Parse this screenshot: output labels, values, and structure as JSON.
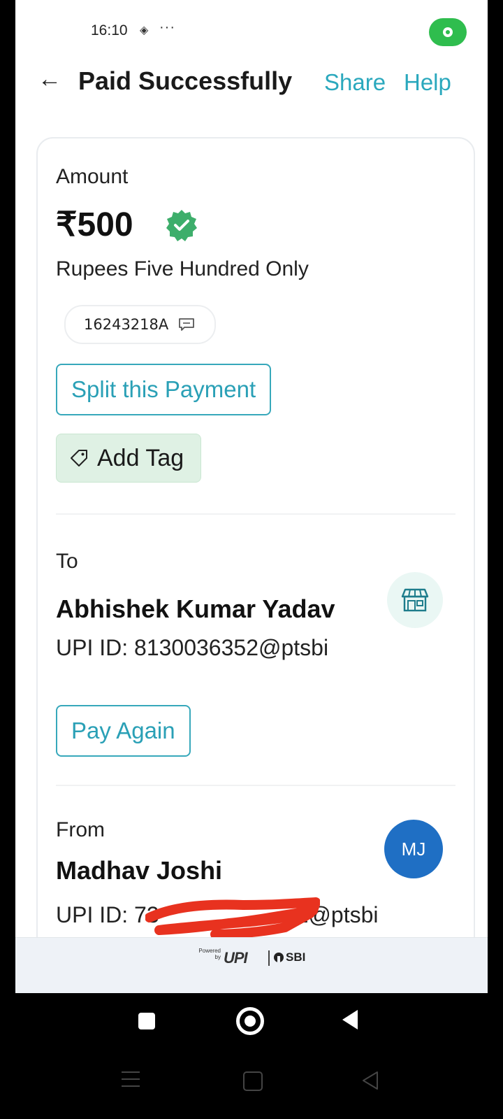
{
  "status_bar": {
    "time": "16:10",
    "icons": [
      "layers-icon",
      "more-dots-icon",
      "location-pill-icon"
    ],
    "dots": "···"
  },
  "header": {
    "back_icon": "arrow-left-icon",
    "title": "Paid Successfully",
    "share_label": "Share",
    "help_label": "Help",
    "accent_color": "#2aa8bd"
  },
  "amount": {
    "label": "Amount",
    "value": "₹500",
    "verified_icon": "verified-badge-icon",
    "in_words": "Rupees Five Hundred Only",
    "note": "16243218A",
    "note_icon": "message-icon"
  },
  "actions": {
    "split_label": "Split this Payment",
    "add_tag_label": "Add Tag",
    "tag_icon": "tag-icon"
  },
  "to": {
    "label": "To",
    "name": "Abhishek Kumar Yadav",
    "upi": "UPI ID: 8130036352@ptsbi",
    "icon": "store-icon",
    "pay_again_label": "Pay Again"
  },
  "from": {
    "label": "From",
    "name": "Madhav Joshi",
    "avatar_initials": "MJ",
    "upi_prefix": "UPI ID: 73",
    "upi_suffix": "2@ptsbi",
    "avatar_color": "#1f6fc4"
  },
  "footer": {
    "powered_by": "Powered by",
    "upi_logo": "UPI",
    "bank": "SBI"
  }
}
